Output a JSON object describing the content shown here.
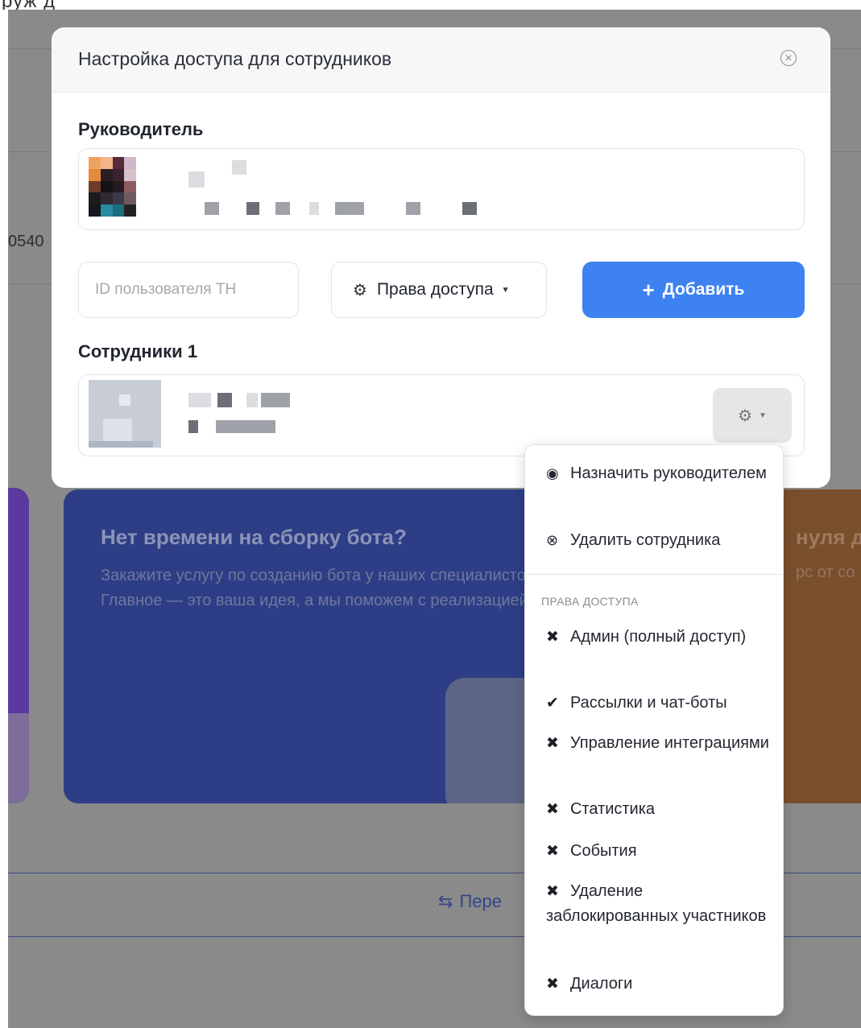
{
  "background": {
    "top_strip_text": "руж д",
    "row_number": "0540",
    "promo_card": {
      "title": "Нет времени на сборку бота?",
      "text": "Закажите услугу по созданию бота у наших специалистов. Главное — это ваша идея, а мы поможем с реализацией"
    },
    "right_card": {
      "title": "нуля д",
      "text": "рс от со"
    },
    "switch_link": "Пере"
  },
  "modal": {
    "title": "Настройка доступа для сотрудников",
    "leader_label": "Руководитель",
    "id_input": {
      "placeholder": "ID пользователя ТН",
      "value": ""
    },
    "rights_button_label": "Права доступа",
    "add_button_label": "Добавить",
    "employees_label": "Сотрудники 1"
  },
  "dropdown": {
    "assign_leader": "Назначить руководителем",
    "delete_employee": "Удалить сотрудника",
    "rights_header": "ПРАВА ДОСТУПА",
    "rights": [
      {
        "label": "Админ (полный доступ)",
        "enabled": false
      },
      {
        "label": "Рассылки и чат-боты",
        "enabled": true
      },
      {
        "label": "Управление интеграциями",
        "enabled": false
      },
      {
        "label": "Статистика",
        "enabled": false
      },
      {
        "label": "События",
        "enabled": false
      },
      {
        "label": "Удаление заблокированных участников",
        "enabled": false
      },
      {
        "label": "Диалоги",
        "enabled": false
      }
    ]
  },
  "icons": {
    "close": "close-circle-icon",
    "gear": "gear-icon",
    "plus": "plus-icon",
    "user": "user-circle-icon",
    "remove": "x-circle-icon",
    "check": "check-icon",
    "cross": "cross-icon",
    "swap": "swap-arrows-icon"
  },
  "colors": {
    "primary_button": "#3d82f0",
    "promo_card": "#2d3e86",
    "overlay_background": "#8a8a8a"
  }
}
